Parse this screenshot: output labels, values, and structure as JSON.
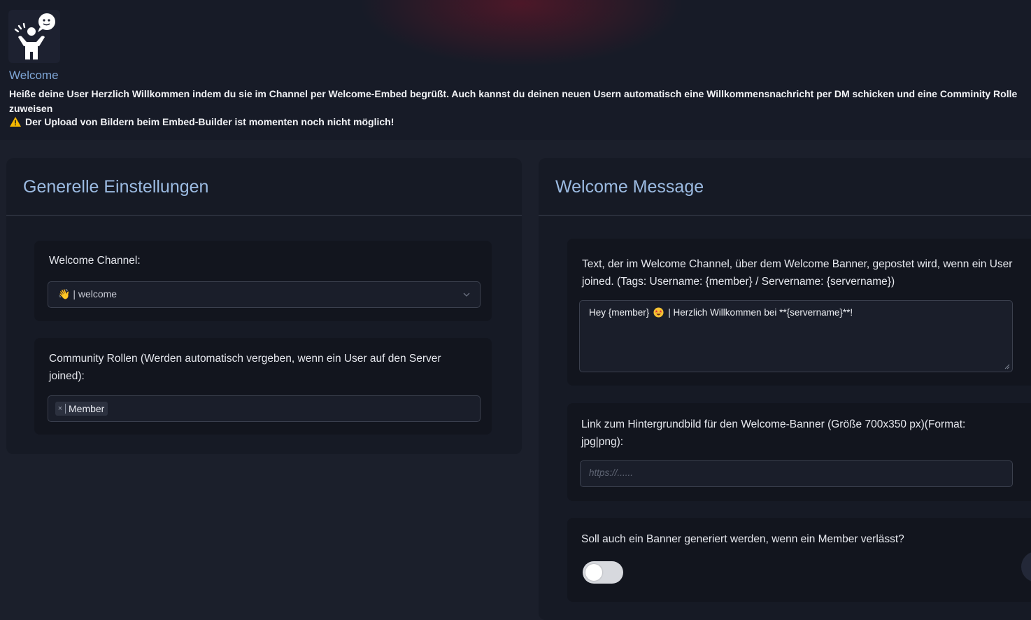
{
  "header": {
    "title": "Welcome",
    "description": "Heiße deine User Herzlich Willkommen indem du sie im Channel per Welcome-Embed begrüßt. Auch kannst du deinen neuen Usern automatisch eine Willkommensnachricht per DM schicken und eine Comminity Rolle zuweisen",
    "warning": "Der Upload von Bildern beim Embed-Builder ist momenten noch nicht möglich!",
    "logo_icon": "waving-person-speech-icon",
    "warning_icon": "warning-triangle-icon"
  },
  "general": {
    "title": "Generelle Einstellungen",
    "channel": {
      "label": "Welcome Channel:",
      "value": "👋 | welcome"
    },
    "roles": {
      "label": "Community Rollen (Werden automatisch vergeben, wenn ein User auf den Server joined):",
      "tags": [
        "Member"
      ],
      "remove_symbol": "×"
    }
  },
  "welcome_message": {
    "title": "Welcome Message",
    "text": {
      "label": "Text, der im Welcome Channel, über dem Welcome Banner, gepostet wird, wenn ein User joined. (Tags: Username: {member} / Servername: {servername})",
      "value_before_emoji": "Hey {member}",
      "value_after_emoji": "| Herzlich Willkommen bei **{servername}**!"
    },
    "background": {
      "label": "Link zum Hintergrundbild für den Welcome-Banner (Größe 700x350 px)(Format: jpg|png):",
      "placeholder": "https://......",
      "value": ""
    },
    "leave_banner": {
      "label": "Soll auch ein Banner generiert werden, wenn ein Member verlässt?",
      "enabled": false
    }
  },
  "colors": {
    "accent_title": "#7fa6d6",
    "card_title": "#9cbbe2",
    "background": "#1b1f2b",
    "warning": "#f5b800"
  }
}
